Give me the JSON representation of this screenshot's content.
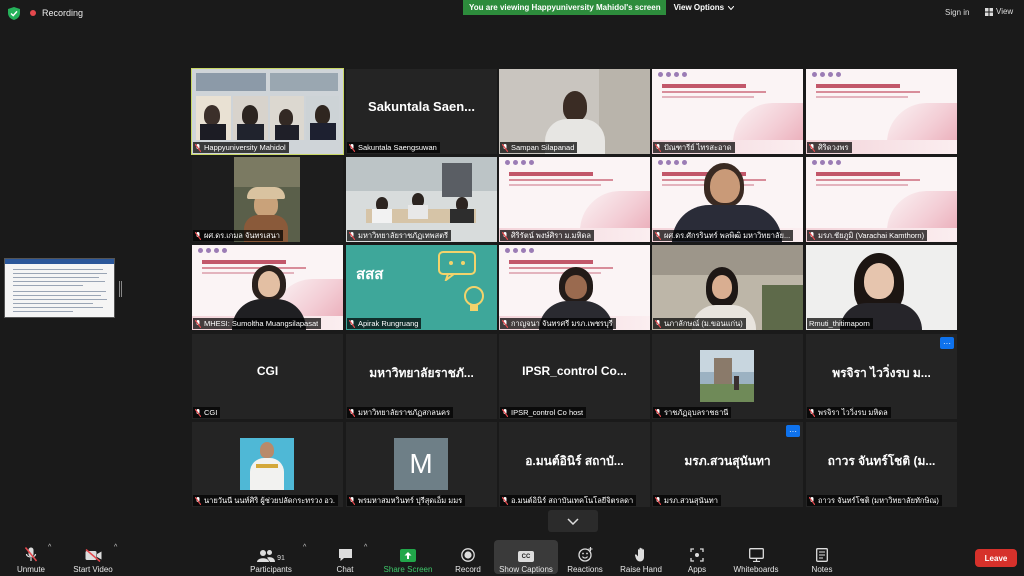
{
  "topbar": {
    "recording_label": "Recording",
    "viewing_banner": "You are viewing Happyuniversity Mahidol's screen",
    "view_options_label": "View Options",
    "sign_in_label": "Sign in",
    "view_label": "View"
  },
  "tiles": [
    {
      "name": "Happyuniversity Mahidol"
    },
    {
      "name": "Sakuntala Saengsuwan",
      "big": "Sakuntala Saen..."
    },
    {
      "name": "Sampan Silapanad"
    },
    {
      "name": "ปัณฑารีย์ ไทรสะอาด"
    },
    {
      "name": "ศิริดวงพร"
    },
    {
      "name": "ผศ.ดร.เกมล จันทรเสนา"
    },
    {
      "name": "มหาวิทยาลัยราชภัฏเทพสตรี"
    },
    {
      "name": "ศิริรัตน์ พงษ์ศิรา ม.มหิดล"
    },
    {
      "name": "ผศ.ดร.ศักรรินทร์ พลพิฒิ มหาวิทยาลัย..."
    },
    {
      "name": "มรภ.ชัยภูมิ (Varachai Kamthorn)"
    },
    {
      "name": "MHESI: Sumoltha Muangsilapasat"
    },
    {
      "name": "Apirak Rungruang"
    },
    {
      "name": "กาญจนา จันทรศรี มรภ.เพชรบุรี"
    },
    {
      "name": "นภาลักษณ์ (ม.ขอนแก่น)"
    },
    {
      "name": "Rmuti_thitimaporn"
    },
    {
      "name": "CGI",
      "big": "CGI"
    },
    {
      "name": "มหาวิทยาลัยราชภัฏสกลนคร",
      "big": "มหาวิทยาลัยราชภั..."
    },
    {
      "name": "IPSR_control Co host",
      "big": "IPSR_control Co..."
    },
    {
      "name": "ราชภัฏอุบลราชธานี"
    },
    {
      "name": "พรจิรา ไววิ่งรบ มหิดล",
      "big": "พรจิรา ไววิ่งรบ ม..."
    },
    {
      "name": "นายวันนี นนท์ศิริ ผู้ช่วยปลัดกระทรวง อว."
    },
    {
      "name": "พรมหาสมหวินทร์ ปุรีสุดเอ็ม มมร",
      "avatar_letter": "M"
    },
    {
      "name": "อ.มนต์อินิร์ สถาบันเทคโนโลยีจิตรลดา",
      "big": "อ.มนต์อินิร์ สถาบั..."
    },
    {
      "name": "มรภ.สวนสุนันทา",
      "big": "มรภ.สวนสุนันทา"
    },
    {
      "name": "ถาวร จันทร์โชติ (มหาวิทยาลัยทักษิณ)",
      "big": "ถาวร จันทร์โชติ (ม..."
    }
  ],
  "reaction_badge": "···",
  "toolbar": {
    "unmute": "Unmute",
    "start_video": "Start Video",
    "participants": "Participants",
    "participants_count": "91",
    "chat": "Chat",
    "share_screen": "Share Screen",
    "record": "Record",
    "show_captions": "Show Captions",
    "cc_badge": "CC",
    "reactions": "Reactions",
    "raise_hand": "Raise Hand",
    "apps": "Apps",
    "whiteboards": "Whiteboards",
    "notes": "Notes",
    "leave": "Leave"
  },
  "colors": {
    "background": "#1a1a1a",
    "tile": "#242424",
    "active_speaker": "#c8d765",
    "banner_green": "#2d8c3c",
    "leave_red": "#d6312b",
    "accent_blue": "#0e72ed"
  },
  "icons": [
    "shield-check-icon",
    "recording-dot-icon",
    "muted-mic-icon",
    "video-off-icon",
    "participants-icon",
    "chat-icon",
    "share-screen-icon",
    "record-icon",
    "cc-icon",
    "reactions-icon",
    "raise-hand-icon",
    "apps-icon",
    "whiteboard-icon",
    "notes-icon",
    "chevron-down-icon"
  ]
}
